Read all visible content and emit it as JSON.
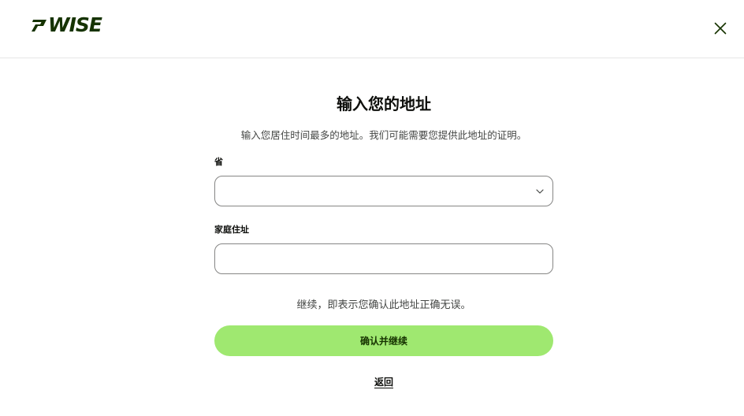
{
  "header": {
    "logo_text": "WISE",
    "brand_color": "#163300",
    "close_icon": "close-icon"
  },
  "form": {
    "title": "输入您的地址",
    "subtitle": "输入您居住时间最多的地址。我们可能需要您提供此地址的证明。",
    "province": {
      "label": "省",
      "selected_value": "",
      "icon": "chevron-down-icon"
    },
    "address": {
      "label": "家庭住址",
      "value": "",
      "placeholder": ""
    },
    "notice": "继续，即表示您确认此地址正确无误。",
    "confirm_button": "确认并继续",
    "back_link": "返回"
  },
  "colors": {
    "accent": "#9fe870",
    "text": "#0e0f0c",
    "muted_text": "#454745",
    "border": "#868685"
  }
}
